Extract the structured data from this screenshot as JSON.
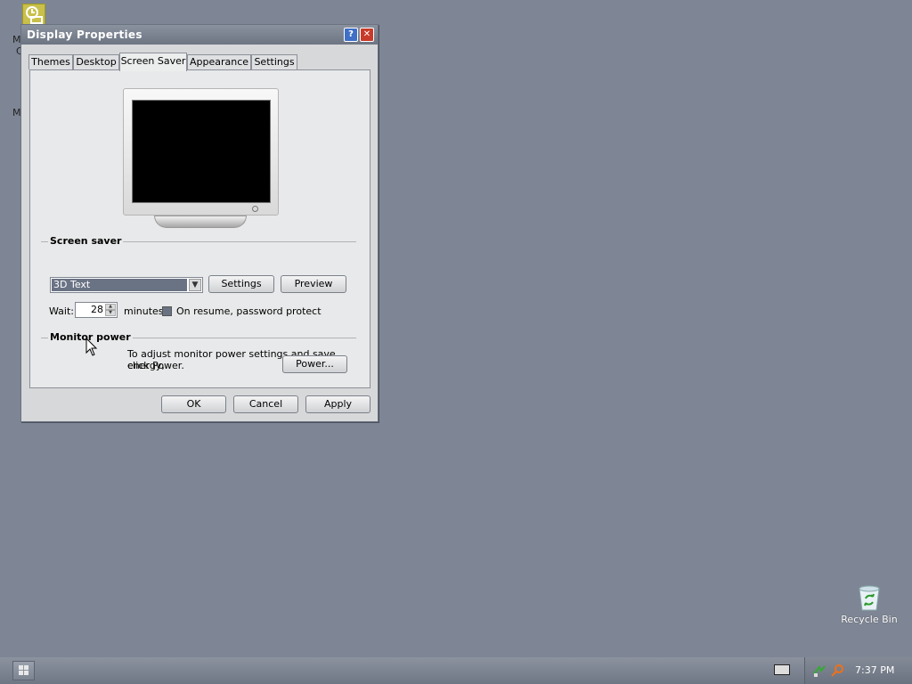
{
  "desktop": {
    "top_icon": "control-panel-icon",
    "stray_texts": [
      "M",
      "C",
      "M"
    ],
    "recycle_bin_label": "Recycle Bin"
  },
  "window": {
    "title": "Display Properties",
    "help_glyph": "?",
    "close_glyph": "✕",
    "tabs": [
      "Themes",
      "Desktop",
      "Screen Saver",
      "Appearance",
      "Settings"
    ],
    "active_tab": "Screen Saver",
    "screen_saver": {
      "group_label": "Screen saver",
      "selected": "3D Text",
      "settings_button": "Settings",
      "preview_button": "Preview",
      "wait_label": "Wait:",
      "wait_value": "28",
      "minutes_label": "minutes",
      "resume_label": "On resume, password protect"
    },
    "monitor_power": {
      "group_label": "Monitor power",
      "description_line1": "To adjust monitor power settings and save energy,",
      "description_line2": "click Power.",
      "power_button": "Power..."
    },
    "footer": {
      "ok": "OK",
      "cancel": "Cancel",
      "apply": "Apply"
    }
  },
  "taskbar": {
    "clock": "7:37 PM"
  }
}
